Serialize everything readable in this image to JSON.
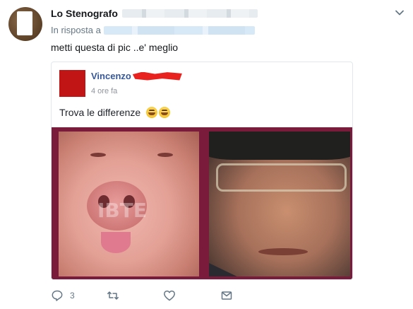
{
  "tweet": {
    "author_name": "Lo Stenografo",
    "reply_prefix": "In risposta a",
    "text": "metti questa di pic ..e' meglio",
    "reply_count": "3"
  },
  "embedded_post": {
    "author_name": "Vincenzo",
    "timestamp": "4 ore fa",
    "text": "Trova le differenze",
    "watermark": "IBTE"
  },
  "icons": {
    "more": "chevron-down-icon",
    "reply": "reply-icon",
    "retweet": "retweet-icon",
    "like": "heart-icon",
    "dm": "envelope-icon"
  },
  "colors": {
    "link": "#365899",
    "muted": "#657786",
    "redaction": "#e8221e"
  }
}
